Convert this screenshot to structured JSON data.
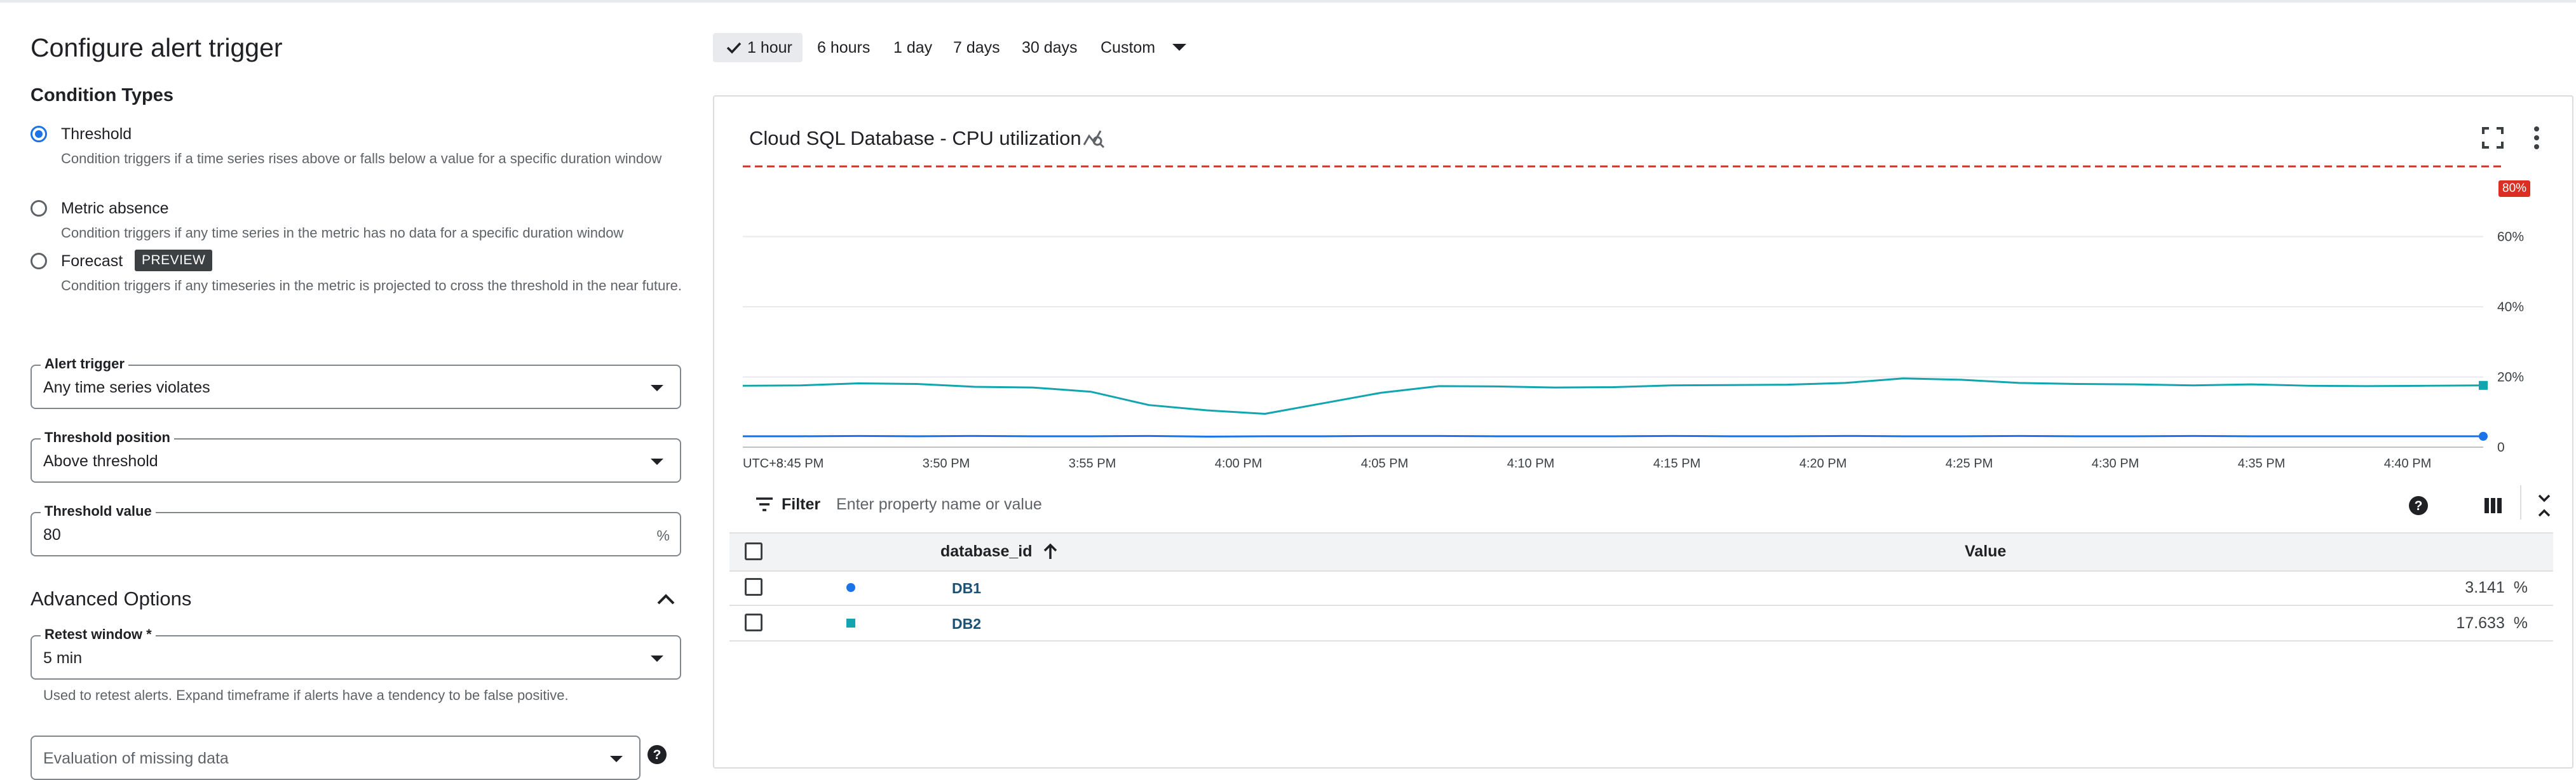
{
  "left": {
    "title": "Configure alert trigger",
    "condition_types": {
      "heading": "Condition Types",
      "options": [
        {
          "label": "Threshold",
          "desc": "Condition triggers if a time series rises above or falls below a value for a specific duration window",
          "selected": true
        },
        {
          "label": "Metric absence",
          "desc": "Condition triggers if any time series in the metric has no data for a specific duration window",
          "selected": false
        },
        {
          "label": "Forecast",
          "badge": "PREVIEW",
          "desc": "Condition triggers if any timeseries in the metric is projected to cross the threshold in the near future.",
          "selected": false
        }
      ]
    },
    "alert_trigger": {
      "label": "Alert trigger",
      "value": "Any time series violates"
    },
    "threshold_position": {
      "label": "Threshold position",
      "value": "Above threshold"
    },
    "threshold_value": {
      "label": "Threshold value",
      "value": "80",
      "unit": "%"
    },
    "advanced": {
      "heading": "Advanced Options",
      "retest_window": {
        "label": "Retest window *",
        "value": "5 min",
        "hint": "Used to retest alerts. Expand timeframe if alerts have a tendency to be false positive."
      },
      "missing_data": {
        "placeholder": "Evaluation of missing data"
      }
    }
  },
  "time_range": {
    "options": [
      "1 hour",
      "6 hours",
      "1 day",
      "7 days",
      "30 days",
      "Custom"
    ],
    "selected": "1 hour"
  },
  "chart": {
    "title": "Cloud SQL Database - CPU utilization",
    "threshold_badge": "80%",
    "timezone": "UTC+8",
    "filter": {
      "label": "Filter",
      "placeholder": "Enter property name or value"
    },
    "table": {
      "columns": [
        "database_id",
        "Value"
      ],
      "rows": [
        {
          "name": "DB1",
          "value": "3.141",
          "unit": "%",
          "marker": "circle",
          "color": "#1a73e8"
        },
        {
          "name": "DB2",
          "value": "17.633",
          "unit": "%",
          "marker": "square",
          "color": "#12a4af"
        }
      ]
    }
  },
  "chart_data": {
    "type": "line",
    "title": "Cloud SQL Database - CPU utilization",
    "xlabel": "",
    "ylabel": "",
    "ylim": [
      0,
      80
    ],
    "yticks": [
      "0",
      "20%",
      "40%",
      "60%"
    ],
    "xticks": [
      "3:45 PM",
      "3:50 PM",
      "3:55 PM",
      "4:00 PM",
      "4:05 PM",
      "4:10 PM",
      "4:15 PM",
      "4:20 PM",
      "4:25 PM",
      "4:30 PM",
      "4:35 PM",
      "4:40 PM"
    ],
    "threshold": 80,
    "x": [
      "3:43 PM",
      "3:45 PM",
      "3:47 PM",
      "3:49 PM",
      "3:51 PM",
      "3:53 PM",
      "3:55 PM",
      "3:57 PM",
      "3:59 PM",
      "4:00 PM",
      "4:02 PM",
      "4:04 PM",
      "4:06 PM",
      "4:08 PM",
      "4:10 PM",
      "4:12 PM",
      "4:14 PM",
      "4:16 PM",
      "4:18 PM",
      "4:20 PM",
      "4:22 PM",
      "4:24 PM",
      "4:26 PM",
      "4:28 PM",
      "4:30 PM",
      "4:32 PM",
      "4:34 PM",
      "4:36 PM",
      "4:38 PM",
      "4:40 PM",
      "4:42 PM"
    ],
    "series": [
      {
        "name": "DB1",
        "color": "#1a73e8",
        "values": [
          3.1,
          3.1,
          3.2,
          3.1,
          3.2,
          3.1,
          3.1,
          3.2,
          3.0,
          3.1,
          3.1,
          3.2,
          3.2,
          3.1,
          3.1,
          3.1,
          3.2,
          3.1,
          3.1,
          3.2,
          3.1,
          3.1,
          3.2,
          3.1,
          3.1,
          3.2,
          3.1,
          3.1,
          3.1,
          3.1,
          3.1
        ]
      },
      {
        "name": "DB2",
        "color": "#12a4af",
        "values": [
          17.5,
          17.6,
          18.2,
          18.0,
          17.2,
          17.0,
          15.8,
          12.0,
          10.5,
          9.5,
          12.5,
          15.5,
          17.4,
          17.3,
          17.0,
          17.1,
          17.6,
          17.7,
          17.8,
          18.3,
          19.6,
          19.2,
          18.3,
          18.0,
          17.9,
          17.6,
          17.9,
          17.5,
          17.4,
          17.5,
          17.6
        ]
      }
    ]
  }
}
